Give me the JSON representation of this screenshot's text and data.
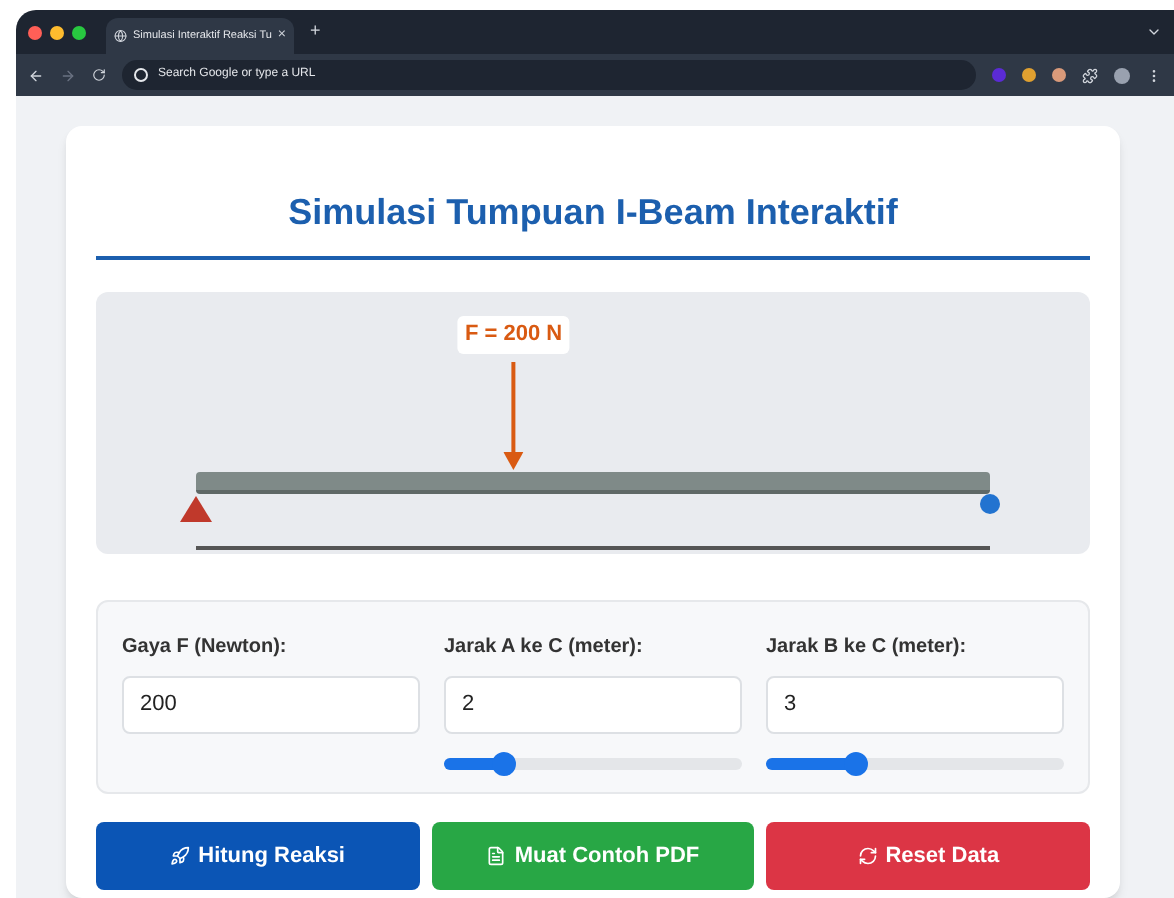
{
  "browser": {
    "tab_title": "Simulasi Interaktif Reaksi Tu",
    "tab_close": "×",
    "new_tab": "+",
    "address_placeholder": "Search Google or type a URL"
  },
  "title": "Simulasi Tumpuan I-Beam Interaktif",
  "diagram": {
    "force_label": "F = 200 N"
  },
  "inputs": [
    {
      "label": "Gaya F (Newton):",
      "value": "200",
      "kind": "number"
    },
    {
      "label": "Jarak A ke C (meter):",
      "value": "2",
      "kind": "slider",
      "level": 0.2
    },
    {
      "label": "Jarak B ke C (meter):",
      "value": "3",
      "kind": "slider",
      "level": 0.3
    }
  ],
  "buttons": [
    {
      "label": "Hitung Reaksi",
      "kind": "calculate"
    },
    {
      "label": "Muat Contoh PDF",
      "kind": "load"
    },
    {
      "label": "Reset Data",
      "kind": "reset"
    }
  ]
}
